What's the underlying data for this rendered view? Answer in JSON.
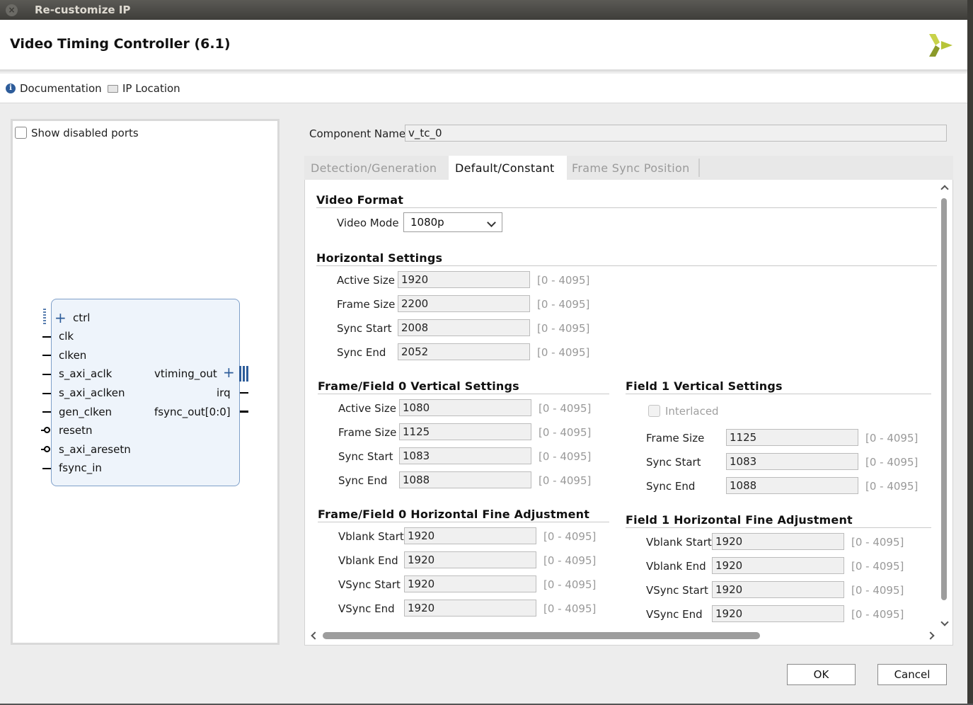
{
  "window": {
    "title": "Re-customize IP",
    "close_glyph": "×"
  },
  "header": {
    "title": "Video Timing Controller (6.1)"
  },
  "links": {
    "documentation": "Documentation",
    "ip_location": "IP Location"
  },
  "left": {
    "show_disabled_ports": "Show disabled ports",
    "ports_left": [
      "ctrl",
      "clk",
      "clken",
      "s_axi_aclk",
      "s_axi_aclken",
      "gen_clken",
      "resetn",
      "s_axi_aresetn",
      "fsync_in"
    ],
    "ports_right": [
      "vtiming_out",
      "irq",
      "fsync_out[0:0]"
    ]
  },
  "component": {
    "label": "Component Name",
    "value": "v_tc_0"
  },
  "tabs": [
    "Detection/Generation",
    "Default/Constant",
    "Frame Sync Position"
  ],
  "video_format": {
    "title": "Video Format",
    "mode_label": "Video Mode",
    "mode_value": "1080p"
  },
  "horizontal": {
    "title": "Horizontal Settings",
    "rows": [
      {
        "label": "Active Size",
        "value": "1920",
        "range": "[0 - 4095]"
      },
      {
        "label": "Frame Size",
        "value": "2200",
        "range": "[0 - 4095]"
      },
      {
        "label": "Sync Start",
        "value": "2008",
        "range": "[0 - 4095]"
      },
      {
        "label": "Sync End",
        "value": "2052",
        "range": "[0 - 4095]"
      }
    ]
  },
  "f0_vertical": {
    "title": "Frame/Field 0 Vertical Settings",
    "rows": [
      {
        "label": "Active Size",
        "value": "1080",
        "range": "[0 - 4095]"
      },
      {
        "label": "Frame Size",
        "value": "1125",
        "range": "[0 - 4095]"
      },
      {
        "label": "Sync Start",
        "value": "1083",
        "range": "[0 - 4095]"
      },
      {
        "label": "Sync End",
        "value": "1088",
        "range": "[0 - 4095]"
      }
    ]
  },
  "f1_vertical": {
    "title": "Field 1 Vertical Settings",
    "interlaced": "Interlaced",
    "rows": [
      {
        "label": "Frame Size",
        "value": "1125",
        "range": "[0 - 4095]"
      },
      {
        "label": "Sync Start",
        "value": "1083",
        "range": "[0 - 4095]"
      },
      {
        "label": "Sync End",
        "value": "1088",
        "range": "[0 - 4095]"
      }
    ]
  },
  "f0_hfine": {
    "title": "Frame/Field 0 Horizontal Fine Adjustment",
    "rows": [
      {
        "label": "Vblank Start",
        "value": "1920",
        "range": "[0 - 4095]"
      },
      {
        "label": "Vblank End",
        "value": "1920",
        "range": "[0 - 4095]"
      },
      {
        "label": "VSync Start",
        "value": "1920",
        "range": "[0 - 4095]"
      },
      {
        "label": "VSync End",
        "value": "1920",
        "range": "[0 - 4095]"
      }
    ]
  },
  "f1_hfine": {
    "title": "Field 1 Horizontal Fine Adjustment",
    "rows": [
      {
        "label": "Vblank Start",
        "value": "1920",
        "range": "[0 - 4095]"
      },
      {
        "label": "Vblank End",
        "value": "1920",
        "range": "[0 - 4095]"
      },
      {
        "label": "VSync Start",
        "value": "1920",
        "range": "[0 - 4095]"
      },
      {
        "label": "VSync End",
        "value": "1920",
        "range": "[0 - 4095]"
      }
    ]
  },
  "buttons": {
    "ok": "OK",
    "cancel": "Cancel"
  },
  "colors": {
    "logo_light": "#c8d24a",
    "logo_dark": "#8b9a2a",
    "block_border": "#7fa0c9",
    "block_fill": "#eef4fb"
  }
}
